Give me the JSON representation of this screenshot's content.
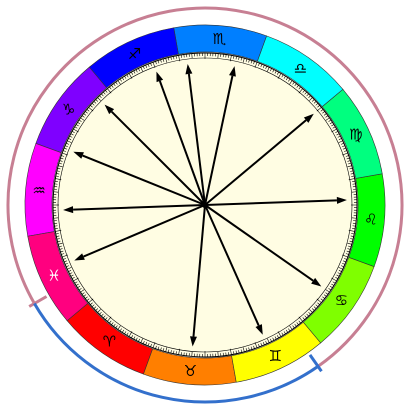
{
  "signs": [
    {
      "key": "aries",
      "glyph": "♈︎",
      "color": "#ff0000",
      "glyph_color": "#000000"
    },
    {
      "key": "taurus",
      "glyph": "♉︎",
      "color": "#ff7f00",
      "glyph_color": "#000000"
    },
    {
      "key": "gemini",
      "glyph": "♊︎",
      "color": "#ffff00",
      "glyph_color": "#000000"
    },
    {
      "key": "cancer",
      "glyph": "♋︎",
      "color": "#7fff00",
      "glyph_color": "#000000"
    },
    {
      "key": "leo",
      "glyph": "♌︎",
      "color": "#00ff00",
      "glyph_color": "#000000"
    },
    {
      "key": "virgo",
      "glyph": "♍︎",
      "color": "#00ff7f",
      "glyph_color": "#000000"
    },
    {
      "key": "libra",
      "glyph": "♎︎",
      "color": "#00ffff",
      "glyph_color": "#000000"
    },
    {
      "key": "scorpio",
      "glyph": "♏︎",
      "color": "#007fff",
      "glyph_color": "#000000"
    },
    {
      "key": "sagittarius",
      "glyph": "♐︎",
      "color": "#0000ff",
      "glyph_color": "#000000"
    },
    {
      "key": "capricorn",
      "glyph": "♑︎",
      "color": "#7f00ff",
      "glyph_color": "#000000"
    },
    {
      "key": "aquarius",
      "glyph": "♒︎",
      "color": "#ff00ff",
      "glyph_color": "#000000"
    },
    {
      "key": "pisces",
      "glyph": "♓︎",
      "color": "#ff007f",
      "glyph_color": "#ffffff"
    }
  ],
  "arrow_angles_deg": [
    178,
    202,
    225,
    250,
    263,
    282,
    320,
    358,
    395,
    426,
    455,
    517
  ],
  "outer_arcs": [
    {
      "name": "arc-pinkish",
      "color": "#c77f93",
      "start_deg": 150,
      "end_deg": 415
    },
    {
      "name": "arc-blue",
      "color": "#3370cc",
      "start_deg": 415,
      "end_deg": 510
    }
  ],
  "colors": {
    "face": "#fffde3",
    "arrow": "#000000",
    "tick": "#000000",
    "ring_outline": "#333333"
  }
}
